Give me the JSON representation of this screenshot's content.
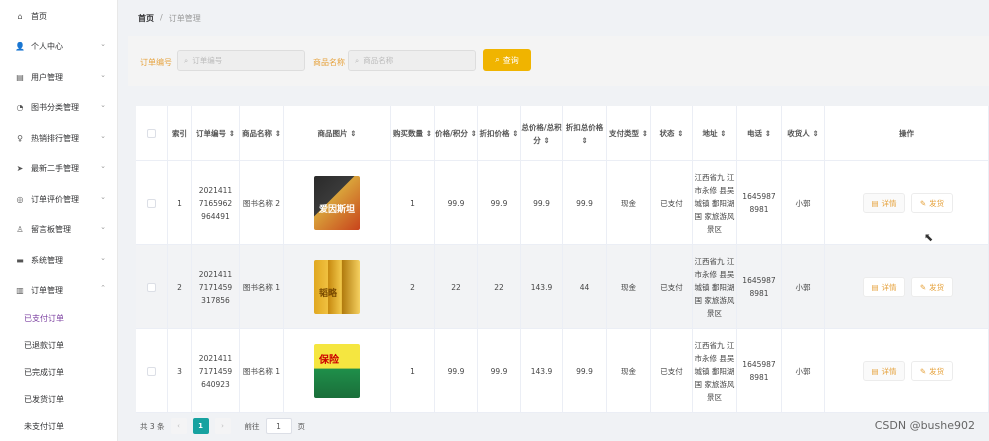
{
  "sidebar": {
    "items": [
      {
        "icon": "home-icon",
        "glyph": "⌂",
        "label": "首页",
        "chevron": false
      },
      {
        "icon": "user-icon",
        "glyph": "👤",
        "label": "个人中心",
        "chevron": true
      },
      {
        "icon": "users-icon",
        "glyph": "▤",
        "label": "用户管理",
        "chevron": true
      },
      {
        "icon": "clock-icon",
        "glyph": "◔",
        "label": "图书分类管理",
        "chevron": true
      },
      {
        "icon": "bulb-icon",
        "glyph": "♀",
        "label": "热销排行管理",
        "chevron": true
      },
      {
        "icon": "send-icon",
        "glyph": "➤",
        "label": "最新二手管理",
        "chevron": true
      },
      {
        "icon": "chat-icon",
        "glyph": "◎",
        "label": "订单评价管理",
        "chevron": true
      },
      {
        "icon": "board-icon",
        "glyph": "♙",
        "label": "留言板管理",
        "chevron": true
      },
      {
        "icon": "system-icon",
        "glyph": "▬",
        "label": "系统管理",
        "chevron": true
      },
      {
        "icon": "order-icon",
        "glyph": "▥",
        "label": "订单管理",
        "chevron": true
      }
    ],
    "sub_items": [
      {
        "label": "已支付订单",
        "active": true
      },
      {
        "label": "已退款订单",
        "active": false
      },
      {
        "label": "已完成订单",
        "active": false
      },
      {
        "label": "已发货订单",
        "active": false
      },
      {
        "label": "未支付订单",
        "active": false
      }
    ]
  },
  "breadcrumb": {
    "home": "首页",
    "sep": "/",
    "current": "订单管理"
  },
  "search": {
    "order_label": "订单编号",
    "order_placeholder": "订单编号",
    "product_label": "商品名称",
    "product_placeholder": "商品名称",
    "button": "查询"
  },
  "table": {
    "headers": [
      "",
      "索引",
      "订单编号 ⇕",
      "商品名称 ⇕",
      "商品图片 ⇕",
      "购买数量 ⇕",
      "价格/积分 ⇕",
      "折扣价格 ⇕",
      "总价格/总积分 ⇕",
      "折扣总价格 ⇕",
      "支付类型 ⇕",
      "状态 ⇕",
      "地址 ⇕",
      "电话 ⇕",
      "收货人 ⇕",
      "操作"
    ],
    "rows": [
      {
        "index": "1",
        "order_no": "2021411 7165962 964491",
        "name": "图书名称 2",
        "book_title": "爱因斯坦",
        "qty": "1",
        "price": "99.9",
        "discount": "99.9",
        "total": "99.9",
        "discount_total": "99.9",
        "pay_type": "现金",
        "status": "已支付",
        "address": "江西省九 江市永修 县吴城镇 鄱阳湖国 家旅游风 景区",
        "phone": "1645987 8981",
        "receiver": "小郭"
      },
      {
        "index": "2",
        "order_no": "2021411 7171459 317856",
        "name": "图书名称 1",
        "book_title": "韬略",
        "qty": "2",
        "price": "22",
        "discount": "22",
        "total": "143.9",
        "discount_total": "44",
        "pay_type": "现金",
        "status": "已支付",
        "address": "江西省九 江市永修 县吴城镇 鄱阳湖国 家旅游风 景区",
        "phone": "1645987 8981",
        "receiver": "小郭"
      },
      {
        "index": "3",
        "order_no": "2021411 7171459 640923",
        "name": "图书名称 1",
        "book_title": "保险",
        "qty": "1",
        "price": "99.9",
        "discount": "99.9",
        "total": "143.9",
        "discount_total": "99.9",
        "pay_type": "现金",
        "status": "已支付",
        "address": "江西省九 江市永修 县吴城镇 鄱阳湖国 家旅游风 景区",
        "phone": "1645987 8981",
        "receiver": "小郭"
      }
    ],
    "detail_button": "详情",
    "ship_button": "发货"
  },
  "pagination": {
    "total": "共 3 条",
    "current": "1",
    "goto": "前往",
    "page_input": "1",
    "page_suffix": "页"
  },
  "watermark": "CSDN @bushe902",
  "colors": {
    "accent": "#e6a23c",
    "search_button": "#f0b400",
    "active_sub": "#7b3fa0",
    "pager_active": "#17a2a0"
  }
}
